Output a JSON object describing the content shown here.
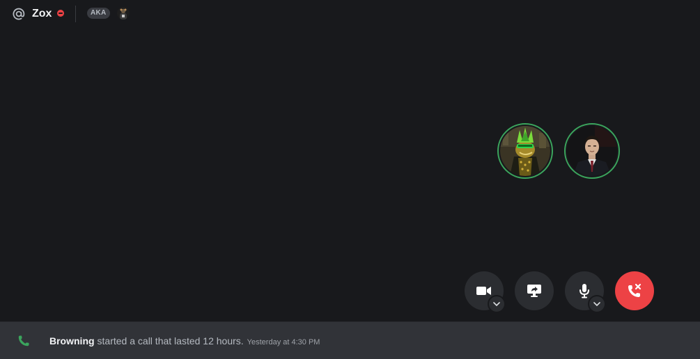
{
  "header": {
    "icon": "at-icon",
    "title": "Zox",
    "status": "do-not-disturb",
    "aka_label": "AKA"
  },
  "call": {
    "participants": [
      {
        "avatar": "green-mohawk-character-avatar",
        "speaking_ring_color": "#3ba55d"
      },
      {
        "avatar": "man-in-suit-avatar",
        "speaking_ring_color": "#3ba55d"
      }
    ],
    "controls": [
      {
        "name": "camera",
        "icon": "video-camera-icon",
        "has_options": true
      },
      {
        "name": "screen-share",
        "icon": "screen-share-icon",
        "has_options": false
      },
      {
        "name": "microphone",
        "icon": "microphone-icon",
        "has_options": true
      },
      {
        "name": "disconnect",
        "icon": "hang-up-icon",
        "has_options": false
      }
    ]
  },
  "message": {
    "icon": "phone-icon",
    "author": "Browning",
    "text": "started a call that lasted 12 hours.",
    "timestamp": "Yesterday at 4:30 PM"
  },
  "colors": {
    "background": "#18191c",
    "message_bar": "#313338",
    "control_button": "#2b2d31",
    "hangup": "#ed4245",
    "speaking": "#3ba55d",
    "dnd": "#ed4245",
    "call_icon": "#3ba55d"
  }
}
